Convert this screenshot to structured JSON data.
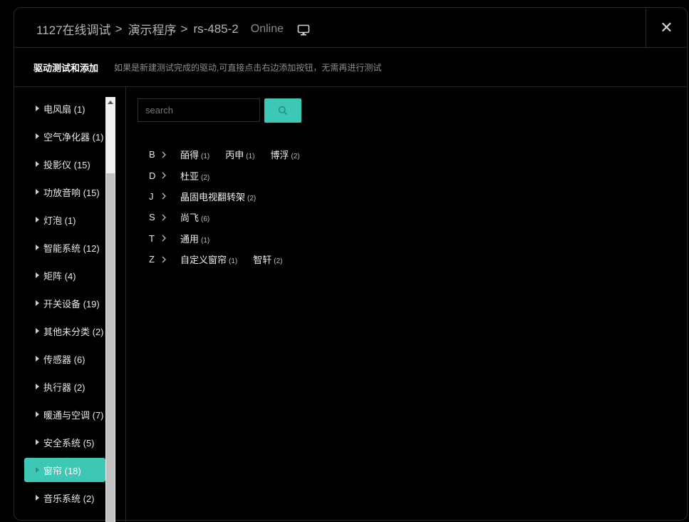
{
  "header": {
    "breadcrumb": [
      "1127在线调试",
      "演示程序",
      "rs-485-2"
    ],
    "status": "Online",
    "close_label": "✕"
  },
  "subheader": {
    "title": "驱动测试和添加",
    "description": "如果是新建测试完成的驱动,可直接点击右边添加按钮，无需再进行测试"
  },
  "sidebar": {
    "items": [
      {
        "label": "电风扇 (1)"
      },
      {
        "label": "空气净化器 (1)"
      },
      {
        "label": "投影仪 (15)"
      },
      {
        "label": "功放音响 (15)"
      },
      {
        "label": "灯泡 (1)"
      },
      {
        "label": "智能系统 (12)"
      },
      {
        "label": "矩阵 (4)"
      },
      {
        "label": "开关设备 (19)"
      },
      {
        "label": "其他未分类 (2)"
      },
      {
        "label": "传感器 (6)"
      },
      {
        "label": "执行器 (2)"
      },
      {
        "label": "暖通与空调 (7)"
      },
      {
        "label": "安全系统 (5)"
      },
      {
        "label": "窗帘 (18)",
        "active": true
      },
      {
        "label": "音乐系统 (2)"
      }
    ]
  },
  "search": {
    "placeholder": "search",
    "value": ""
  },
  "brand_groups": [
    {
      "letter": "B",
      "brands": [
        {
          "name": "皕得",
          "count": "(1)"
        },
        {
          "name": "丙申",
          "count": "(1)"
        },
        {
          "name": "博浮",
          "count": "(2)"
        }
      ]
    },
    {
      "letter": "D",
      "brands": [
        {
          "name": "杜亚",
          "count": "(2)"
        }
      ]
    },
    {
      "letter": "J",
      "brands": [
        {
          "name": "晶固电视翻转架",
          "count": "(2)"
        }
      ]
    },
    {
      "letter": "S",
      "brands": [
        {
          "name": "尚飞",
          "count": "(6)"
        }
      ]
    },
    {
      "letter": "T",
      "brands": [
        {
          "name": "通用",
          "count": "(1)"
        }
      ]
    },
    {
      "letter": "Z",
      "brands": [
        {
          "name": "自定义窗帘",
          "count": "(1)"
        },
        {
          "name": "智轩",
          "count": "(2)"
        }
      ]
    }
  ],
  "colors": {
    "accent": "#3cc8b4",
    "background": "#000000",
    "border": "#262626"
  },
  "icons": {
    "monitor": "monitor-icon",
    "search": "search-icon",
    "close": "close-icon",
    "chevron": "chevron-right-icon"
  }
}
